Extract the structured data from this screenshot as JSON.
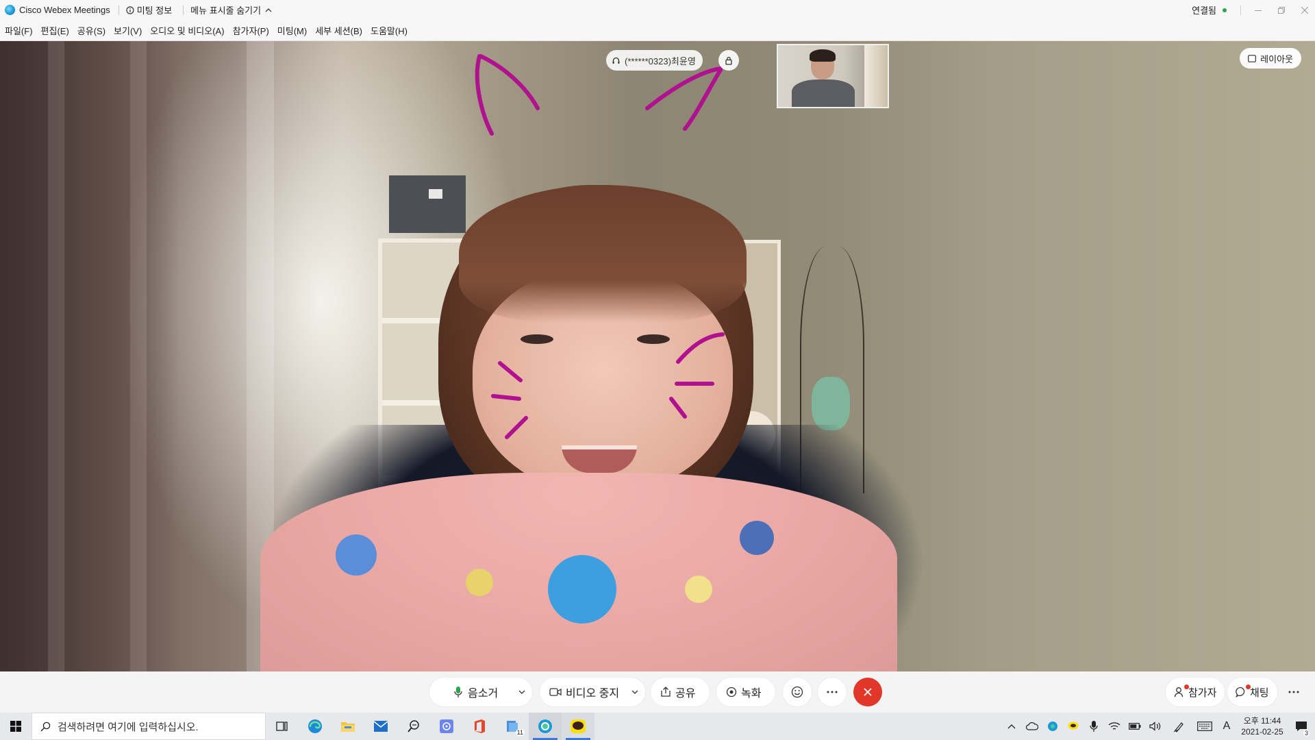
{
  "titlebar": {
    "app_title": "Cisco Webex Meetings",
    "meeting_info": "미팅 정보",
    "hide_menu": "메뉴 표시줄 숨기기",
    "connection_status": "연결됨"
  },
  "menu": {
    "items": [
      "파일(F)",
      "편집(E)",
      "공유(S)",
      "보기(V)",
      "오디오 및 비디오(A)",
      "참가자(P)",
      "미팅(M)",
      "세부 세션(B)",
      "도움말(H)"
    ]
  },
  "video": {
    "participant_name": "(******0323)최윤영",
    "layout_label": "레이아웃"
  },
  "controls": {
    "mute_label": "음소거",
    "stop_video_label": "비디오 중지",
    "share_label": "공유",
    "record_label": "녹화",
    "participants_label": "참가자",
    "chat_label": "채팅"
  },
  "taskbar": {
    "search_placeholder": "검색하려면 여기에 입력하십시오.",
    "file_explorer_badge": "11",
    "ime_label": "A",
    "time": "오후 11:44",
    "date": "2021-02-25",
    "notifications_count": "3"
  },
  "colors": {
    "accent": "#3b78d8",
    "end_call": "#e0372a",
    "connected": "#2aa44f",
    "drawing": "#b0128f"
  }
}
